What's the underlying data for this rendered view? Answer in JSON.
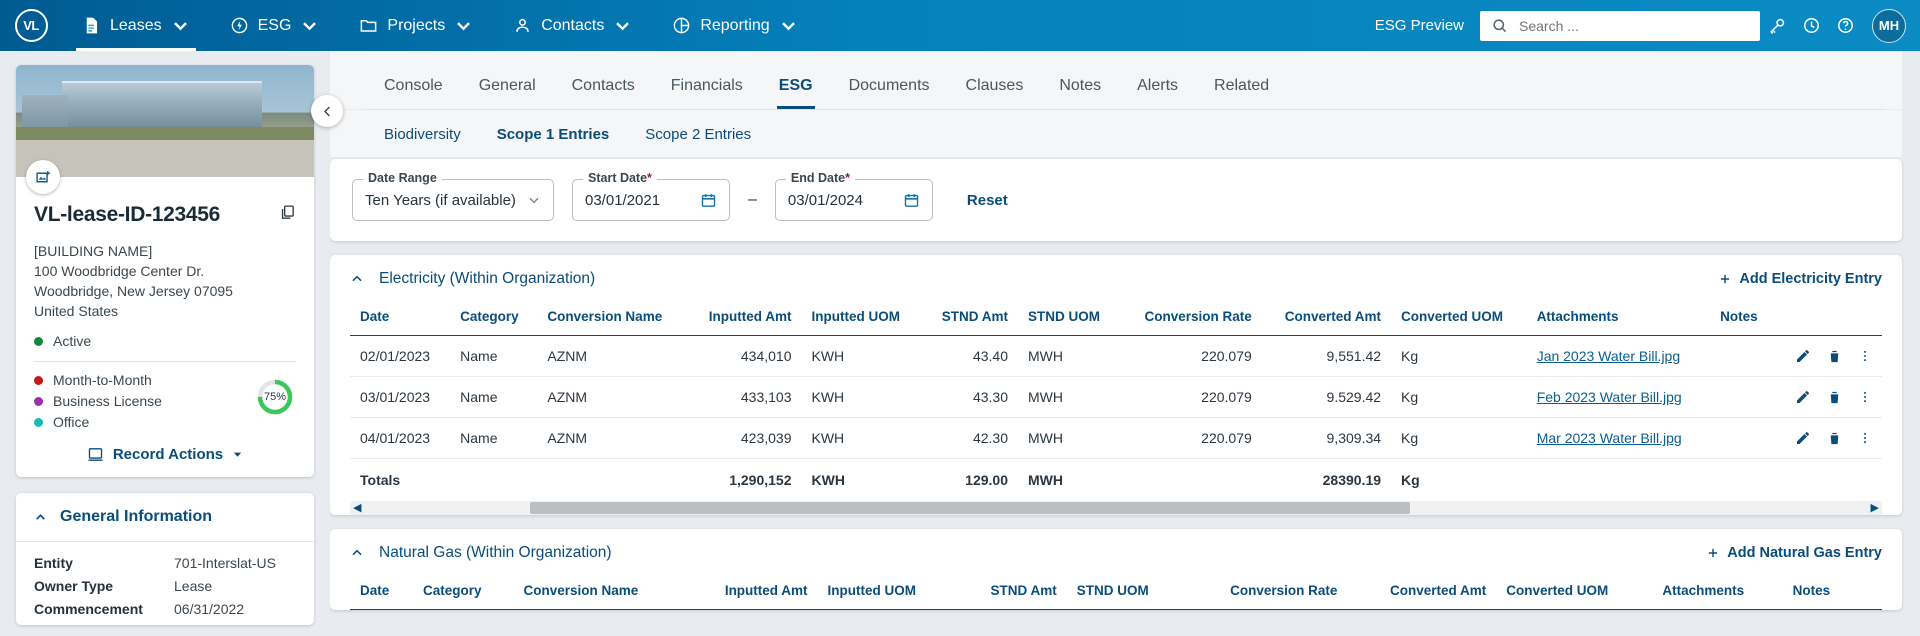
{
  "topnav": {
    "logo_text": "VL",
    "items": [
      {
        "label": "Leases",
        "icon": "document-icon",
        "active": true
      },
      {
        "label": "ESG",
        "icon": "energy-bolt-icon",
        "active": false
      },
      {
        "label": "Projects",
        "icon": "folder-icon",
        "active": false
      },
      {
        "label": "Contacts",
        "icon": "person-icon",
        "active": false
      },
      {
        "label": "Reporting",
        "icon": "pie-chart-icon",
        "active": false
      }
    ],
    "esg_preview": "ESG Preview",
    "search_placeholder": "Search ...",
    "search_value": "",
    "avatar_initials": "MH",
    "accent": "#0580bb"
  },
  "sidebar": {
    "record_title": "VL-lease-ID-123456",
    "address": [
      "[BUILDING NAME]",
      "100 Woodbridge Center Dr.",
      "Woodbridge, New Jersey 07095",
      "United States"
    ],
    "status": {
      "label": "Active",
      "color": "#13883c"
    },
    "tags": [
      {
        "label": "Month-to-Month",
        "color": "#c8161d"
      },
      {
        "label": "Business License",
        "color": "#9b2fae"
      },
      {
        "label": "Office",
        "color": "#12bdb5"
      }
    ],
    "progress": {
      "value": "75%",
      "color": "#3cc75a"
    },
    "record_actions": "Record Actions",
    "general_information": {
      "title": "General Information",
      "rows": [
        {
          "key": "Entity",
          "value": "701-Interslat-US"
        },
        {
          "key": "Owner Type",
          "value": "Lease"
        },
        {
          "key": "Commencement",
          "value": "06/31/2022"
        }
      ]
    }
  },
  "tabs": [
    {
      "label": "Console",
      "active": false
    },
    {
      "label": "General",
      "active": false
    },
    {
      "label": "Contacts",
      "active": false
    },
    {
      "label": "Financials",
      "active": false
    },
    {
      "label": "ESG",
      "active": true
    },
    {
      "label": "Documents",
      "active": false
    },
    {
      "label": "Clauses",
      "active": false
    },
    {
      "label": "Notes",
      "active": false
    },
    {
      "label": "Alerts",
      "active": false
    },
    {
      "label": "Related",
      "active": false
    }
  ],
  "subtabs": [
    {
      "label": "Biodiversity",
      "active": false
    },
    {
      "label": "Scope 1 Entries",
      "active": true
    },
    {
      "label": "Scope 2 Entries",
      "active": false
    }
  ],
  "filters": {
    "date_range": {
      "label": "Date Range",
      "value": "Ten Years (if available)"
    },
    "start_date": {
      "label": "Start Date",
      "required": "*",
      "value": "03/01/2021"
    },
    "separator": "–",
    "end_date": {
      "label": "End Date",
      "required": "*",
      "value": "03/01/2024"
    },
    "reset": "Reset"
  },
  "columns": [
    "Date",
    "Category",
    "Conversion Name",
    "Inputted Amt",
    "Inputted UOM",
    "STND Amt",
    "STND UOM",
    "Conversion Rate",
    "Converted Amt",
    "Converted UOM",
    "Attachments",
    "Notes"
  ],
  "sections": [
    {
      "title": "Electricity (Within Organization)",
      "add_label": "Add Electricity Entry",
      "rows": [
        {
          "date": "02/01/2023",
          "category": "Name",
          "conversion_name": "AZNM",
          "inputted_amt": "434,010",
          "inputted_uom": "KWH",
          "stnd_amt": "43.40",
          "stnd_uom": "MWH",
          "conversion_rate": "220.079",
          "converted_amt": "9,551.42",
          "converted_uom": "Kg",
          "attachment": "Jan 2023 Water Bill.jpg",
          "notes": ""
        },
        {
          "date": "03/01/2023",
          "category": "Name",
          "conversion_name": "AZNM",
          "inputted_amt": "433,103",
          "inputted_uom": "KWH",
          "stnd_amt": "43.30",
          "stnd_uom": "MWH",
          "conversion_rate": "220.079",
          "converted_amt": "9.529.42",
          "converted_uom": "Kg",
          "attachment": "Feb 2023 Water Bill.jpg",
          "notes": ""
        },
        {
          "date": "04/01/2023",
          "category": "Name",
          "conversion_name": "AZNM",
          "inputted_amt": "423,039",
          "inputted_uom": "KWH",
          "stnd_amt": "42.30",
          "stnd_uom": "MWH",
          "conversion_rate": "220.079",
          "converted_amt": "9,309.34",
          "converted_uom": "Kg",
          "attachment": "Mar 2023 Water Bill.jpg",
          "notes": ""
        }
      ],
      "totals": {
        "label": "Totals",
        "inputted_amt": "1,290,152",
        "inputted_uom": "KWH",
        "stnd_amt": "129.00",
        "stnd_uom": "MWH",
        "conversion_rate": "",
        "converted_amt": "28390.19",
        "converted_uom": "Kg"
      }
    },
    {
      "title": "Natural Gas (Within Organization)",
      "add_label": "Add Natural Gas Entry",
      "rows": [],
      "totals": null
    }
  ]
}
